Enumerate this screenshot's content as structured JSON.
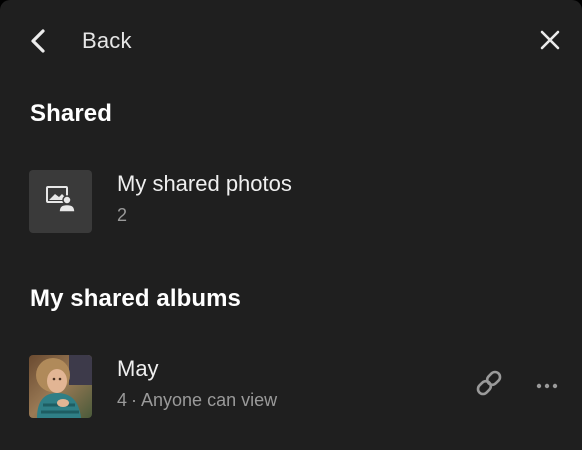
{
  "header": {
    "back_label": "Back",
    "back_icon": "chevron-left-icon",
    "close_icon": "close-icon"
  },
  "sections": {
    "shared": {
      "heading": "Shared",
      "item": {
        "title": "My shared photos",
        "count": "2",
        "icon": "shared-photo-icon"
      }
    },
    "albums": {
      "heading": "My shared albums",
      "items": [
        {
          "title": "May",
          "count": "4",
          "separator": "·",
          "visibility": "Anyone can view",
          "link_icon": "link-icon",
          "more_icon": "more-horizontal-icon"
        }
      ]
    }
  },
  "colors": {
    "background": "#1f1f1f",
    "heading": "#ffffff",
    "text": "#efefef",
    "secondary_text": "#9a9a9a",
    "thumb_bg": "#3a3a3a"
  }
}
